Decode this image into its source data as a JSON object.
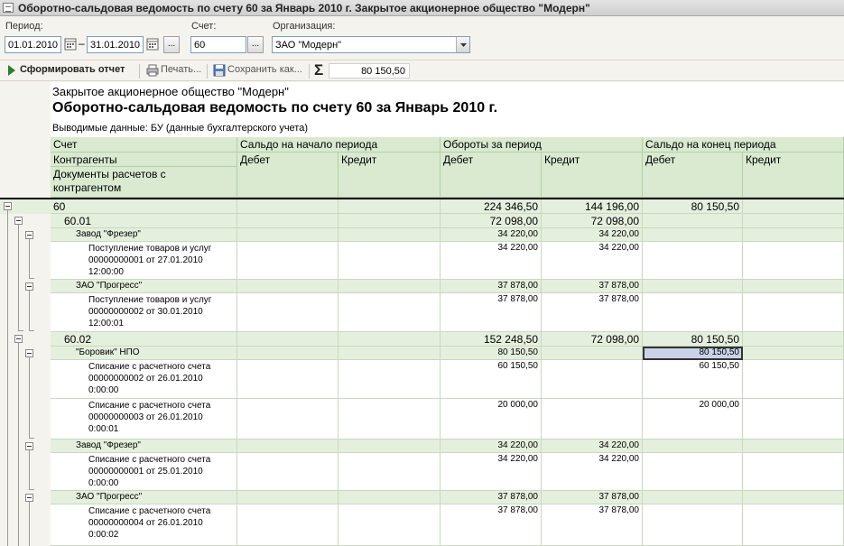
{
  "window": {
    "title": "Оборотно-сальдовая ведомость по счету 60 за Январь 2010 г. Закрытое акционерное общество \"Модерн\""
  },
  "filters": {
    "period_label": "Период:",
    "date_from": "01.01.2010",
    "date_sep": "–",
    "date_to": "31.01.2010",
    "ellipsis": "...",
    "account_label": "Счет:",
    "account_value": "60",
    "org_label": "Организация:",
    "org_value": "ЗАО \"Модерн\""
  },
  "toolbar": {
    "generate": "Сформировать отчет",
    "print": "Печать...",
    "save": "Сохранить как...",
    "sum_symbol": "Σ",
    "sum_value": "80 150,50"
  },
  "report": {
    "org": "Закрытое акционерное общество \"Модерн\"",
    "title": "Оборотно-сальдовая ведомость по счету 60 за Январь 2010 г.",
    "output_data": "Выводимые данные:  БУ (данные бухгалтерского учета)",
    "headers": {
      "account": "Счет",
      "counterparties": "Контрагенты",
      "documents": "Документы расчетов с контрагентом",
      "opening": "Сальдо на начало периода",
      "turnover": "Обороты за период",
      "closing": "Сальдо на конец периода",
      "debit": "Дебет",
      "credit": "Кредит"
    },
    "rows": [
      {
        "label": "60",
        "od": "",
        "oc": "",
        "td": "224 346,50",
        "tc": "144 196,00",
        "cd": "80 150,50",
        "cc": ""
      },
      {
        "label": "60.01",
        "od": "",
        "oc": "",
        "td": "72 098,00",
        "tc": "72 098,00",
        "cd": "",
        "cc": ""
      },
      {
        "label": "Завод \"Фрезер\"",
        "od": "",
        "oc": "",
        "td": "34 220,00",
        "tc": "34 220,00",
        "cd": "",
        "cc": ""
      },
      {
        "label": "Поступление товаров и услуг 00000000001 от 27.01.2010 12:00:00",
        "od": "",
        "oc": "",
        "td": "34 220,00",
        "tc": "34 220,00",
        "cd": "",
        "cc": ""
      },
      {
        "label": "ЗАО \"Прогресс\"",
        "od": "",
        "oc": "",
        "td": "37 878,00",
        "tc": "37 878,00",
        "cd": "",
        "cc": ""
      },
      {
        "label": "Поступление товаров и услуг 00000000002 от 30.01.2010 12:00:01",
        "od": "",
        "oc": "",
        "td": "37 878,00",
        "tc": "37 878,00",
        "cd": "",
        "cc": ""
      },
      {
        "label": "60.02",
        "od": "",
        "oc": "",
        "td": "152 248,50",
        "tc": "72 098,00",
        "cd": "80 150,50",
        "cc": ""
      },
      {
        "label": "\"Боровик\" НПО",
        "od": "",
        "oc": "",
        "td": "80 150,50",
        "tc": "",
        "cd": "80 150,50",
        "cc": ""
      },
      {
        "label": "Списание с расчетного счета 00000000002 от 26.01.2010 0:00:00",
        "od": "",
        "oc": "",
        "td": "60 150,50",
        "tc": "",
        "cd": "60 150,50",
        "cc": ""
      },
      {
        "label": "Списание с расчетного счета 00000000003 от 26.01.2010 0:00:01",
        "od": "",
        "oc": "",
        "td": "20 000,00",
        "tc": "",
        "cd": "20 000,00",
        "cc": ""
      },
      {
        "label": "Завод \"Фрезер\"",
        "od": "",
        "oc": "",
        "td": "34 220,00",
        "tc": "34 220,00",
        "cd": "",
        "cc": ""
      },
      {
        "label": "Списание с расчетного счета 00000000001 от 25.01.2010 0:00:00",
        "od": "",
        "oc": "",
        "td": "34 220,00",
        "tc": "34 220,00",
        "cd": "",
        "cc": ""
      },
      {
        "label": "ЗАО \"Прогресс\"",
        "od": "",
        "oc": "",
        "td": "37 878,00",
        "tc": "37 878,00",
        "cd": "",
        "cc": ""
      },
      {
        "label": "Списание с расчетного счета 00000000004 от 26.01.2010 0:00:02",
        "od": "",
        "oc": "",
        "td": "37 878,00",
        "tc": "37 878,00",
        "cd": "",
        "cc": ""
      }
    ]
  },
  "colors": {
    "header_green": "#d9ead0",
    "group_green": "#e5efdd",
    "selection": "#c9d3e8"
  }
}
